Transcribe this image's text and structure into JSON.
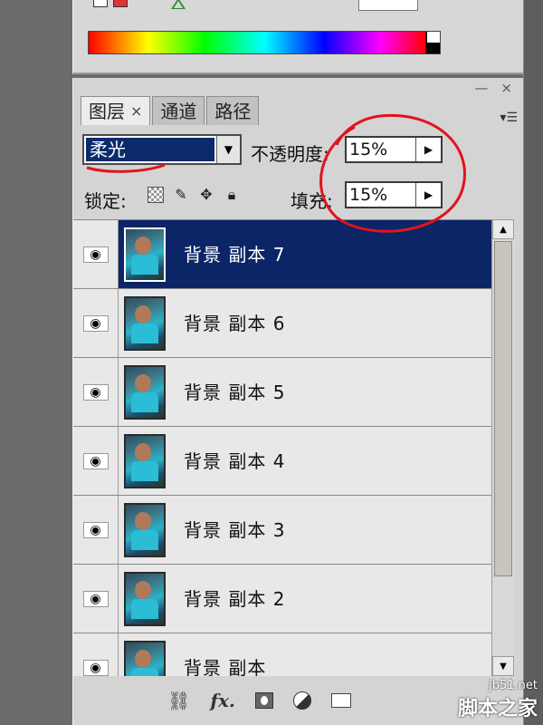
{
  "layers_panel": {
    "tabs": [
      {
        "label": "图层",
        "close": "×"
      },
      {
        "label": "通道"
      },
      {
        "label": "路径"
      }
    ],
    "blend_mode": "柔光",
    "opacity_label": "不透明度:",
    "opacity_value": "15%",
    "lock_label": "锁定:",
    "fill_label": "填充:",
    "fill_value": "15%",
    "layers": [
      {
        "name": "背景 副本 7",
        "selected": true
      },
      {
        "name": "背景 副本 6",
        "selected": false
      },
      {
        "name": "背景 副本 5",
        "selected": false
      },
      {
        "name": "背景 副本 4",
        "selected": false
      },
      {
        "name": "背景 副本 3",
        "selected": false
      },
      {
        "name": "背景 副本 2",
        "selected": false
      },
      {
        "name": "背景 副本",
        "selected": false
      }
    ],
    "panel_controls": {
      "minimize": "—",
      "close": "×",
      "menu": "▾☰"
    }
  },
  "watermark": {
    "url": "jb51.net",
    "text": "脚本之家"
  },
  "colors": {
    "selection": "#0b2566",
    "annotation": "#e0141e"
  }
}
